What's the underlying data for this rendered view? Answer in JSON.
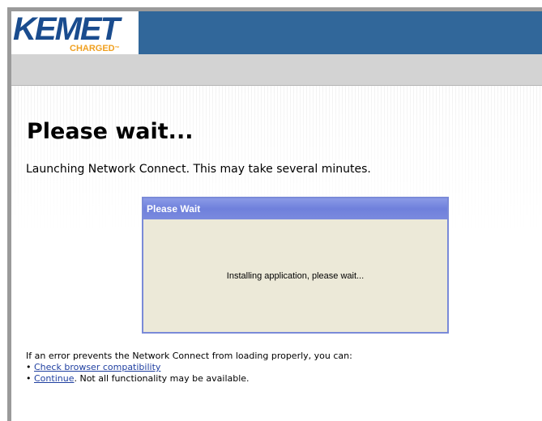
{
  "header": {
    "logo_text": "KEMET",
    "logo_tagline": "CHARGED",
    "logo_tm": "™"
  },
  "main": {
    "title": "Please wait...",
    "subtitle": "Launching Network Connect. This may take several minutes."
  },
  "dialog": {
    "title": "Please Wait",
    "message": "Installing application, please wait..."
  },
  "footer": {
    "error_text": "If an error prevents the Network Connect from loading properly, you can:",
    "bullet": "•",
    "link_check": "Check browser compatibility",
    "link_continue": "Continue",
    "continue_suffix": ". Not all functionality may be available."
  },
  "colors": {
    "header_blue": "#31679a",
    "logo_blue": "#1a4c8e",
    "logo_orange": "#f0a020",
    "band_gray": "#d3d3d3",
    "dialog_bg": "#ece9d8",
    "dialog_title_blue": "#7a8ade",
    "link_blue": "#1f3fa0"
  }
}
